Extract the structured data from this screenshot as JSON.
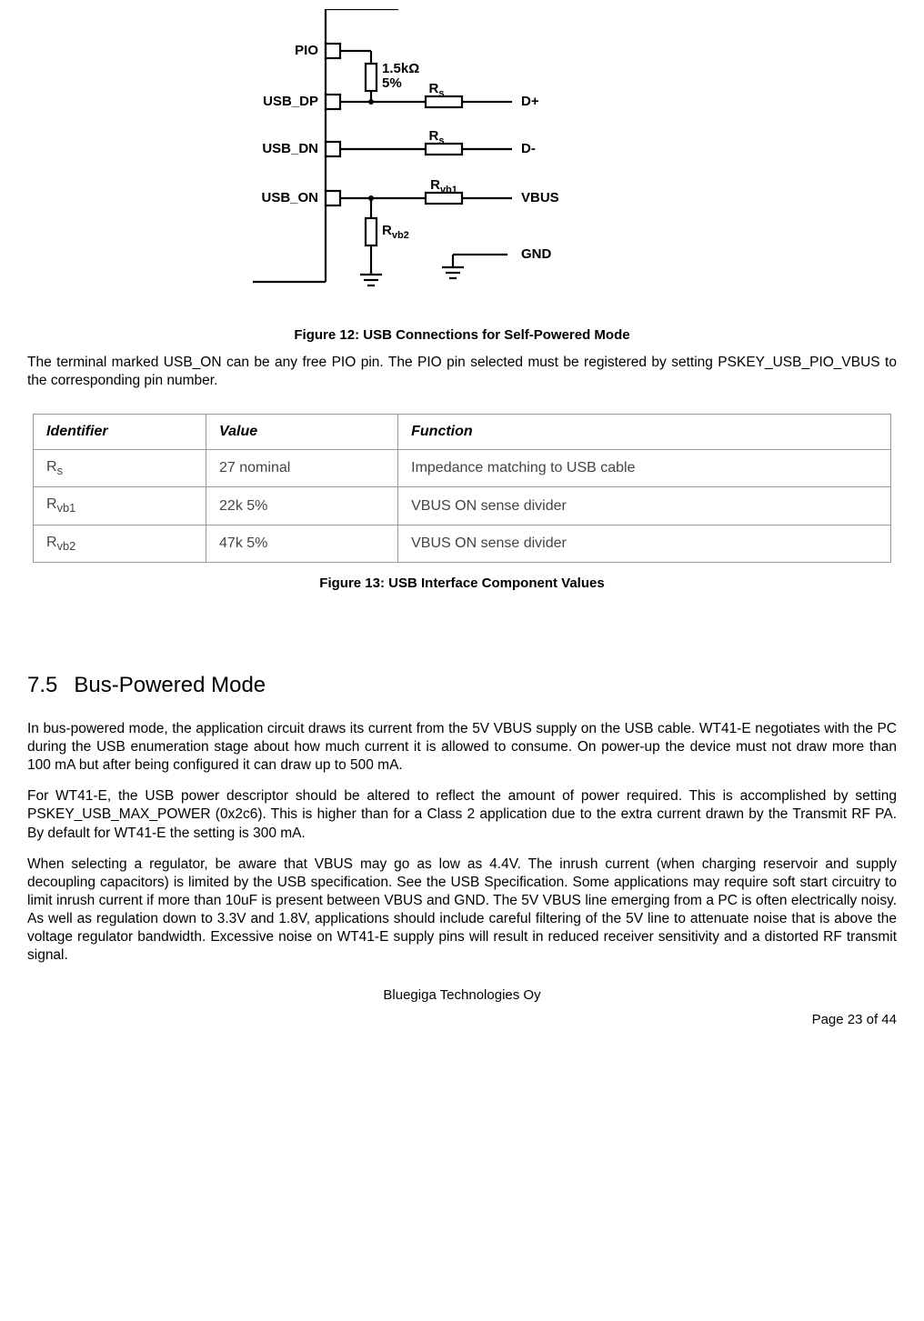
{
  "schematic": {
    "labels": {
      "pio": "PIO",
      "usb_dp": "USB_DP",
      "usb_dn": "USB_DN",
      "usb_on": "USB_ON",
      "r_val": "1.5kΩ",
      "r_tol": "5%",
      "rs1": "R",
      "rs1_sub": "s",
      "rs2": "R",
      "rs2_sub": "s",
      "rvb1": "R",
      "rvb1_sub": "vb1",
      "rvb2": "R",
      "rvb2_sub": "vb2",
      "dplus": "D+",
      "dminus": "D-",
      "vbus": "VBUS",
      "gnd": "GND"
    }
  },
  "figure12_caption": "Figure 12: USB Connections for Self-Powered Mode",
  "para1": "The terminal marked USB_ON can be any free PIO pin. The PIO pin selected must be registered by setting PSKEY_USB_PIO_VBUS to the corresponding pin number.",
  "table": {
    "headers": [
      "Identifier",
      "Value",
      "Function"
    ],
    "rows": [
      {
        "id_html": "R<span class='sub'>s</span>",
        "id_text": "Rs",
        "value": "27 nominal",
        "function": "Impedance matching to USB cable"
      },
      {
        "id_html": "R<span class='sub'>vb1</span>",
        "id_text": "Rvb1",
        "value": "22k 5%",
        "function": "VBUS ON sense divider"
      },
      {
        "id_html": "R<span class='sub'>vb2</span>",
        "id_text": "Rvb2",
        "value": "47k 5%",
        "function": "VBUS ON sense divider"
      }
    ]
  },
  "figure13_caption": "Figure 13: USB Interface Component Values",
  "section": {
    "number": "7.5",
    "title": "Bus-Powered Mode"
  },
  "para2": "In bus-powered mode, the application circuit draws its current from the 5V VBUS supply on the USB cable. WT41-E negotiates with the PC during the USB enumeration stage about how much current it is allowed to consume. On power-up the device must not draw more than 100 mA but after being configured it can draw up to 500 mA.",
  "para3": "For WT41-E, the USB power descriptor should be altered to reflect the amount of power required. This is accomplished by setting PSKEY_USB_MAX_POWER (0x2c6). This is higher than for a Class 2 application due to the extra current drawn by the Transmit RF PA. By default for WT41-E the setting is 300 mA.",
  "para4": "When selecting a regulator, be aware that VBUS may go as low as 4.4V. The inrush current (when charging reservoir and supply decoupling capacitors) is limited by the USB specification. See the USB Specification. Some applications may require soft start circuitry to limit inrush current if more than 10uF is present between VBUS and GND. The 5V VBUS line emerging from a PC is often electrically noisy. As well as regulation down to 3.3V and 1.8V, applications should include careful filtering of the 5V line to attenuate noise that is above the voltage regulator bandwidth. Excessive noise on WT41-E supply pins will result in reduced receiver sensitivity and a distorted RF transmit signal.",
  "footer_company": "Bluegiga Technologies Oy",
  "footer_page": "Page 23 of 44"
}
